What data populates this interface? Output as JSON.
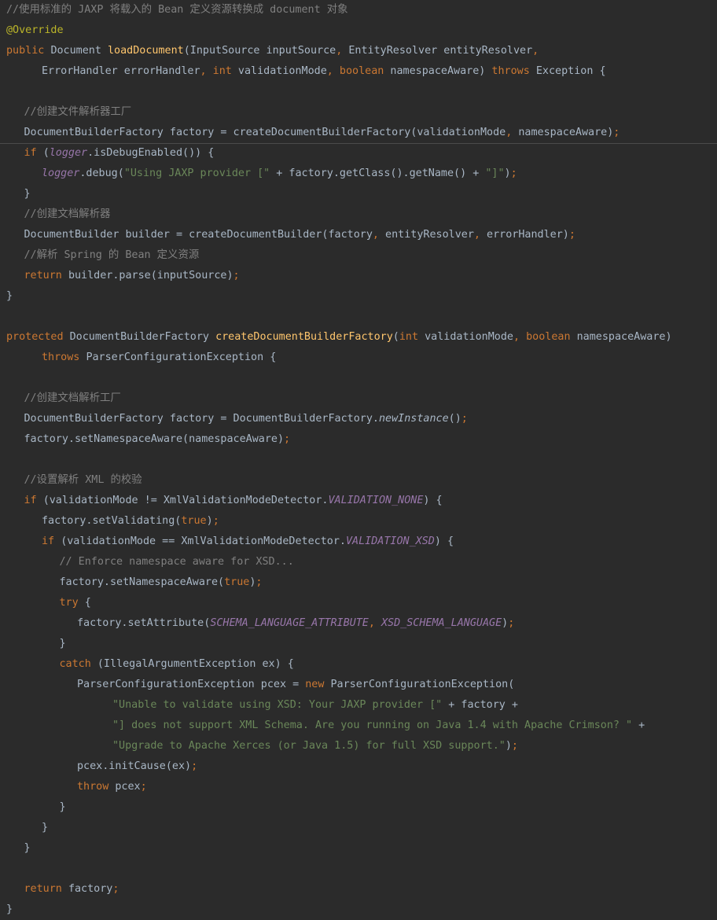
{
  "editor": {
    "language": "java",
    "colors": {
      "background": "#2b2b2b",
      "plain": "#a9b7c6",
      "keyword": "#cc7832",
      "comment": "#808080",
      "string": "#6a8759",
      "annotation": "#bbb529",
      "method_declaration": "#ffc66d",
      "static_field": "#9876aa"
    },
    "lines": [
      {
        "indent": 0,
        "tokens": [
          {
            "t": "comment",
            "v": "//使用标准的 JAXP 将载入的 Bean 定义资源转换成 document 对象"
          }
        ]
      },
      {
        "indent": 0,
        "tokens": [
          {
            "t": "annotation",
            "v": "@Override"
          }
        ]
      },
      {
        "indent": 0,
        "tokens": [
          {
            "t": "kw",
            "v": "public "
          },
          {
            "t": "plain",
            "v": "Document "
          },
          {
            "t": "fn",
            "v": "loadDocument"
          },
          {
            "t": "plain",
            "v": "(InputSource inputSource"
          },
          {
            "t": "punct",
            "v": ", "
          },
          {
            "t": "plain",
            "v": "EntityResolver entityResolver"
          },
          {
            "t": "punct",
            "v": ","
          }
        ]
      },
      {
        "indent": 2,
        "tokens": [
          {
            "t": "plain",
            "v": "ErrorHandler errorHandler"
          },
          {
            "t": "punct",
            "v": ", "
          },
          {
            "t": "kw",
            "v": "int "
          },
          {
            "t": "plain",
            "v": "validationMode"
          },
          {
            "t": "punct",
            "v": ", "
          },
          {
            "t": "kw",
            "v": "boolean "
          },
          {
            "t": "plain",
            "v": "namespaceAware) "
          },
          {
            "t": "kw",
            "v": "throws "
          },
          {
            "t": "plain",
            "v": "Exception {"
          }
        ]
      },
      {
        "indent": 0,
        "tokens": []
      },
      {
        "indent": 1,
        "tokens": [
          {
            "t": "comment",
            "v": "//创建文件解析器工厂"
          }
        ]
      },
      {
        "indent": 1,
        "tokens": [
          {
            "t": "plain",
            "v": "DocumentBuilderFactory factory = createDocumentBuilderFactory(validationMode"
          },
          {
            "t": "punct",
            "v": ", "
          },
          {
            "t": "plain",
            "v": "namespaceAware)"
          },
          {
            "t": "punct",
            "v": ";"
          }
        ]
      },
      {
        "indent": 1,
        "tokens": [
          {
            "t": "kw",
            "v": "if "
          },
          {
            "t": "plain",
            "v": "("
          },
          {
            "t": "field",
            "v": "logger"
          },
          {
            "t": "plain",
            "v": ".isDebugEnabled()) {"
          }
        ]
      },
      {
        "indent": 2,
        "tokens": [
          {
            "t": "field",
            "v": "logger"
          },
          {
            "t": "plain",
            "v": ".debug("
          },
          {
            "t": "string",
            "v": "\"Using JAXP provider [\" "
          },
          {
            "t": "plain",
            "v": "+ factory.getClass().getName() + "
          },
          {
            "t": "string",
            "v": "\"]\""
          },
          {
            "t": "plain",
            "v": ")"
          },
          {
            "t": "punct",
            "v": ";"
          }
        ]
      },
      {
        "indent": 1,
        "tokens": [
          {
            "t": "plain",
            "v": "}"
          }
        ]
      },
      {
        "indent": 1,
        "tokens": [
          {
            "t": "comment",
            "v": "//创建文档解析器"
          }
        ]
      },
      {
        "indent": 1,
        "tokens": [
          {
            "t": "plain",
            "v": "DocumentBuilder builder = createDocumentBuilder(factory"
          },
          {
            "t": "punct",
            "v": ", "
          },
          {
            "t": "plain",
            "v": "entityResolver"
          },
          {
            "t": "punct",
            "v": ", "
          },
          {
            "t": "plain",
            "v": "errorHandler)"
          },
          {
            "t": "punct",
            "v": ";"
          }
        ]
      },
      {
        "indent": 1,
        "tokens": [
          {
            "t": "comment",
            "v": "//解析 Spring 的 Bean 定义资源"
          }
        ]
      },
      {
        "indent": 1,
        "tokens": [
          {
            "t": "kw",
            "v": "return "
          },
          {
            "t": "plain",
            "v": "builder.parse(inputSource)"
          },
          {
            "t": "punct",
            "v": ";"
          }
        ]
      },
      {
        "indent": 0,
        "tokens": [
          {
            "t": "plain",
            "v": "}"
          }
        ]
      },
      {
        "indent": 0,
        "tokens": []
      },
      {
        "indent": 0,
        "tokens": [
          {
            "t": "kw",
            "v": "protected "
          },
          {
            "t": "plain",
            "v": "DocumentBuilderFactory "
          },
          {
            "t": "fn",
            "v": "createDocumentBuilderFactory"
          },
          {
            "t": "plain",
            "v": "("
          },
          {
            "t": "kw",
            "v": "int "
          },
          {
            "t": "plain",
            "v": "validationMode"
          },
          {
            "t": "punct",
            "v": ", "
          },
          {
            "t": "kw",
            "v": "boolean "
          },
          {
            "t": "plain",
            "v": "namespaceAware)"
          }
        ]
      },
      {
        "indent": 2,
        "tokens": [
          {
            "t": "kw",
            "v": "throws "
          },
          {
            "t": "plain",
            "v": "ParserConfigurationException {"
          }
        ]
      },
      {
        "indent": 0,
        "tokens": []
      },
      {
        "indent": 1,
        "tokens": [
          {
            "t": "comment",
            "v": "//创建文档解析工厂"
          }
        ]
      },
      {
        "indent": 1,
        "tokens": [
          {
            "t": "plain",
            "v": "DocumentBuilderFactory factory = DocumentBuilderFactory."
          },
          {
            "t": "italic",
            "v": "newInstance"
          },
          {
            "t": "plain",
            "v": "()"
          },
          {
            "t": "punct",
            "v": ";"
          }
        ]
      },
      {
        "indent": 1,
        "tokens": [
          {
            "t": "plain",
            "v": "factory.setNamespaceAware(namespaceAware)"
          },
          {
            "t": "punct",
            "v": ";"
          }
        ]
      },
      {
        "indent": 0,
        "tokens": []
      },
      {
        "indent": 1,
        "tokens": [
          {
            "t": "comment",
            "v": "//设置解析 XML 的校验"
          }
        ]
      },
      {
        "indent": 1,
        "tokens": [
          {
            "t": "kw",
            "v": "if "
          },
          {
            "t": "plain",
            "v": "(validationMode != XmlValidationModeDetector."
          },
          {
            "t": "field",
            "v": "VALIDATION_NONE"
          },
          {
            "t": "plain",
            "v": ") {"
          }
        ]
      },
      {
        "indent": 2,
        "tokens": [
          {
            "t": "plain",
            "v": "factory.setValidating("
          },
          {
            "t": "kw",
            "v": "true"
          },
          {
            "t": "plain",
            "v": ")"
          },
          {
            "t": "punct",
            "v": ";"
          }
        ]
      },
      {
        "indent": 2,
        "tokens": [
          {
            "t": "kw",
            "v": "if "
          },
          {
            "t": "plain",
            "v": "(validationMode == XmlValidationModeDetector."
          },
          {
            "t": "field",
            "v": "VALIDATION_XSD"
          },
          {
            "t": "plain",
            "v": ") {"
          }
        ]
      },
      {
        "indent": 3,
        "tokens": [
          {
            "t": "comment",
            "v": "// Enforce namespace aware for XSD..."
          }
        ]
      },
      {
        "indent": 3,
        "tokens": [
          {
            "t": "plain",
            "v": "factory.setNamespaceAware("
          },
          {
            "t": "kw",
            "v": "true"
          },
          {
            "t": "plain",
            "v": ")"
          },
          {
            "t": "punct",
            "v": ";"
          }
        ]
      },
      {
        "indent": 3,
        "tokens": [
          {
            "t": "kw",
            "v": "try "
          },
          {
            "t": "plain",
            "v": "{"
          }
        ]
      },
      {
        "indent": 4,
        "tokens": [
          {
            "t": "plain",
            "v": "factory.setAttribute("
          },
          {
            "t": "field",
            "v": "SCHEMA_LANGUAGE_ATTRIBUTE"
          },
          {
            "t": "punct",
            "v": ", "
          },
          {
            "t": "field",
            "v": "XSD_SCHEMA_LANGUAGE"
          },
          {
            "t": "plain",
            "v": ")"
          },
          {
            "t": "punct",
            "v": ";"
          }
        ]
      },
      {
        "indent": 3,
        "tokens": [
          {
            "t": "plain",
            "v": "}"
          }
        ]
      },
      {
        "indent": 3,
        "tokens": [
          {
            "t": "kw",
            "v": "catch "
          },
          {
            "t": "plain",
            "v": "(IllegalArgumentException ex) {"
          }
        ]
      },
      {
        "indent": 4,
        "tokens": [
          {
            "t": "plain",
            "v": "ParserConfigurationException pcex = "
          },
          {
            "t": "kw",
            "v": "new "
          },
          {
            "t": "plain",
            "v": "ParserConfigurationException("
          }
        ]
      },
      {
        "indent": 6,
        "tokens": [
          {
            "t": "string",
            "v": "\"Unable to validate using XSD: Your JAXP provider [\" "
          },
          {
            "t": "plain",
            "v": "+ factory +"
          }
        ]
      },
      {
        "indent": 6,
        "tokens": [
          {
            "t": "string",
            "v": "\"] does not support XML Schema. Are you running on Java 1.4 with Apache Crimson? \" "
          },
          {
            "t": "plain",
            "v": "+"
          }
        ]
      },
      {
        "indent": 6,
        "tokens": [
          {
            "t": "string",
            "v": "\"Upgrade to Apache Xerces (or Java 1.5) for full XSD support.\""
          },
          {
            "t": "plain",
            "v": ")"
          },
          {
            "t": "punct",
            "v": ";"
          }
        ]
      },
      {
        "indent": 4,
        "tokens": [
          {
            "t": "plain",
            "v": "pcex.initCause(ex)"
          },
          {
            "t": "punct",
            "v": ";"
          }
        ]
      },
      {
        "indent": 4,
        "tokens": [
          {
            "t": "kw",
            "v": "throw "
          },
          {
            "t": "plain",
            "v": "pcex"
          },
          {
            "t": "punct",
            "v": ";"
          }
        ]
      },
      {
        "indent": 3,
        "tokens": [
          {
            "t": "plain",
            "v": "}"
          }
        ]
      },
      {
        "indent": 2,
        "tokens": [
          {
            "t": "plain",
            "v": "}"
          }
        ]
      },
      {
        "indent": 1,
        "tokens": [
          {
            "t": "plain",
            "v": "}"
          }
        ]
      },
      {
        "indent": 0,
        "tokens": []
      },
      {
        "indent": 1,
        "tokens": [
          {
            "t": "kw",
            "v": "return "
          },
          {
            "t": "plain",
            "v": "factory"
          },
          {
            "t": "punct",
            "v": ";"
          }
        ]
      },
      {
        "indent": 0,
        "tokens": [
          {
            "t": "plain",
            "v": "}"
          }
        ]
      }
    ]
  }
}
